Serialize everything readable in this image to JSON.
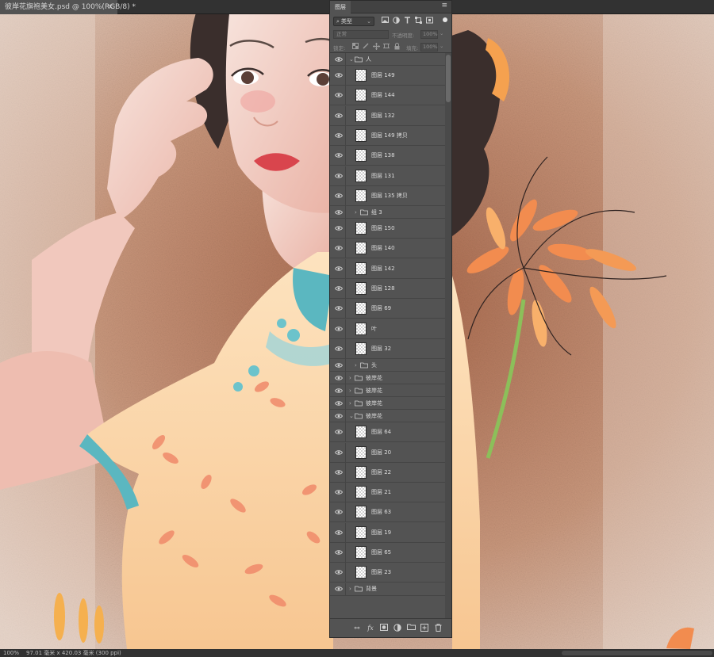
{
  "document_tab": {
    "title": "彼岸花旗袍美女.psd @ 100%(RGB/8) *",
    "close_glyph": "×"
  },
  "status_bar": {
    "zoom": "100%",
    "info": "97.01 毫米 x 420.03 毫米 (300 ppi)",
    "arrow": "‹"
  },
  "layers_panel": {
    "tab_label": "图层",
    "menu_glyph": "≡",
    "filter": {
      "search_glyph": "⌕",
      "kind": "类型",
      "chevron": "⌄",
      "icons": [
        "image-filter-icon",
        "adjustment-filter-icon",
        "text-filter-icon",
        "shape-filter-icon",
        "smart-object-filter-icon"
      ]
    },
    "blend_mode": "正常",
    "opacity_label": "不透明度:",
    "opacity_value": "100%",
    "lock_label": "锁定:",
    "fill_label": "填充:",
    "fill_value": "100%",
    "layers": [
      {
        "kind": "group",
        "name": "人",
        "expanded": true,
        "indent": 0
      },
      {
        "kind": "layer",
        "name": "图层 149",
        "indent": 1
      },
      {
        "kind": "layer",
        "name": "图层 144",
        "indent": 1
      },
      {
        "kind": "layer",
        "name": "图层 132",
        "indent": 1
      },
      {
        "kind": "layer",
        "name": "图层 149 拷贝",
        "indent": 1
      },
      {
        "kind": "layer",
        "name": "图层 138",
        "indent": 1
      },
      {
        "kind": "layer",
        "name": "图层 131",
        "indent": 1
      },
      {
        "kind": "layer",
        "name": "图层 135 拷贝",
        "indent": 1
      },
      {
        "kind": "group",
        "name": "组 3",
        "expanded": false,
        "indent": 1
      },
      {
        "kind": "layer",
        "name": "图层 150",
        "indent": 1
      },
      {
        "kind": "layer",
        "name": "图层 140",
        "indent": 1
      },
      {
        "kind": "layer",
        "name": "图层 142",
        "indent": 1
      },
      {
        "kind": "layer",
        "name": "图层 128",
        "indent": 1
      },
      {
        "kind": "layer",
        "name": "图层 69",
        "indent": 1
      },
      {
        "kind": "layer",
        "name": "叶",
        "indent": 1
      },
      {
        "kind": "layer",
        "name": "图层 32",
        "indent": 1
      },
      {
        "kind": "group",
        "name": "头",
        "expanded": false,
        "indent": 1
      },
      {
        "kind": "group",
        "name": "彼岸花",
        "expanded": false,
        "indent": 0
      },
      {
        "kind": "group",
        "name": "彼岸花",
        "expanded": false,
        "indent": 0
      },
      {
        "kind": "group",
        "name": "彼岸花",
        "expanded": false,
        "indent": 0
      },
      {
        "kind": "group",
        "name": "彼岸花",
        "expanded": true,
        "indent": 0
      },
      {
        "kind": "layer",
        "name": "图层 64",
        "indent": 1
      },
      {
        "kind": "layer",
        "name": "图层 20",
        "indent": 1
      },
      {
        "kind": "layer",
        "name": "图层 22",
        "indent": 1
      },
      {
        "kind": "layer",
        "name": "图层 21",
        "indent": 1
      },
      {
        "kind": "layer",
        "name": "图层 63",
        "indent": 1
      },
      {
        "kind": "layer",
        "name": "图层 19",
        "indent": 1
      },
      {
        "kind": "layer",
        "name": "图层 65",
        "indent": 1
      },
      {
        "kind": "layer",
        "name": "图层 23",
        "indent": 1
      },
      {
        "kind": "group",
        "name": "背景",
        "expanded": false,
        "indent": 0
      }
    ],
    "footer": {
      "link_glyph": "⚯",
      "fx_label": "fx"
    }
  },
  "colors": {
    "canvas_background": "#d9b8a2",
    "qipao": "#fcd9ac",
    "trim": "#5bb7c0",
    "flower": "#f28c4f",
    "stem": "#8cbf5a",
    "skin": "#f5ddd3",
    "hair": "#3a2e2c"
  }
}
